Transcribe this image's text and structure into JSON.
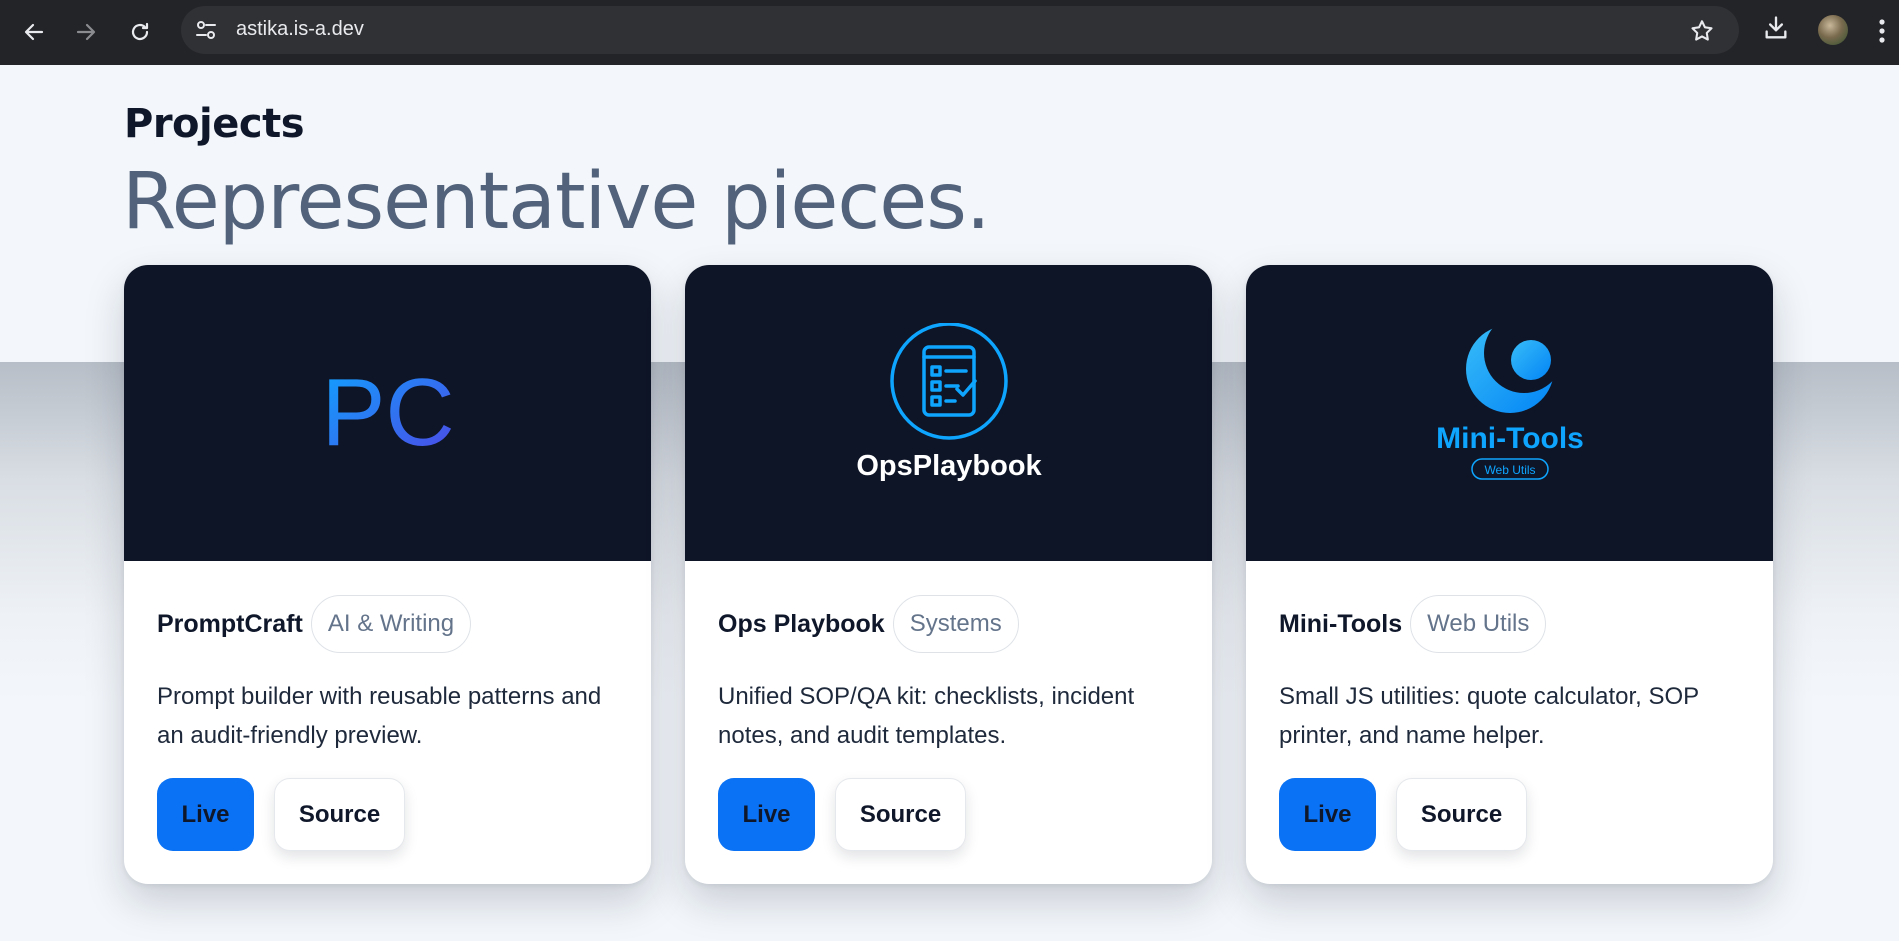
{
  "browser": {
    "url": "astika.is-a.dev",
    "icons": {
      "back": "back-arrow-icon",
      "forward": "forward-arrow-icon",
      "reload": "reload-icon",
      "site_info": "site-settings-icon",
      "bookmark": "star-icon",
      "download": "download-icon",
      "profile": "avatar",
      "menu": "kebab-menu-icon"
    }
  },
  "section": {
    "eyebrow": "Projects",
    "headline": "Representative pieces."
  },
  "projects": [
    {
      "logo_text": "PC",
      "title": "PromptCraft",
      "tag": "AI & Writing",
      "description": "Prompt builder with reusable patterns and an audit-friendly preview.",
      "live_label": "Live",
      "source_label": "Source"
    },
    {
      "logo_text": "OpsPlaybook",
      "title": "Ops Playbook",
      "tag": "Systems",
      "description": "Unified SOP/QA kit: checklists, incident notes, and audit templates.",
      "live_label": "Live",
      "source_label": "Source"
    },
    {
      "logo_text": "Mini-Tools",
      "logo_subtext": "Web Utils",
      "title": "Mini-Tools",
      "tag": "Web Utils",
      "description": "Small JS utilities: quote calculator, SOP printer, and name helper.",
      "live_label": "Live",
      "source_label": "Source"
    }
  ],
  "colors": {
    "live_button": "#0a72f5",
    "card_thumb_bg": "#0e1527",
    "headline": "#52627a",
    "logo_blue": "#0ea5ff"
  }
}
